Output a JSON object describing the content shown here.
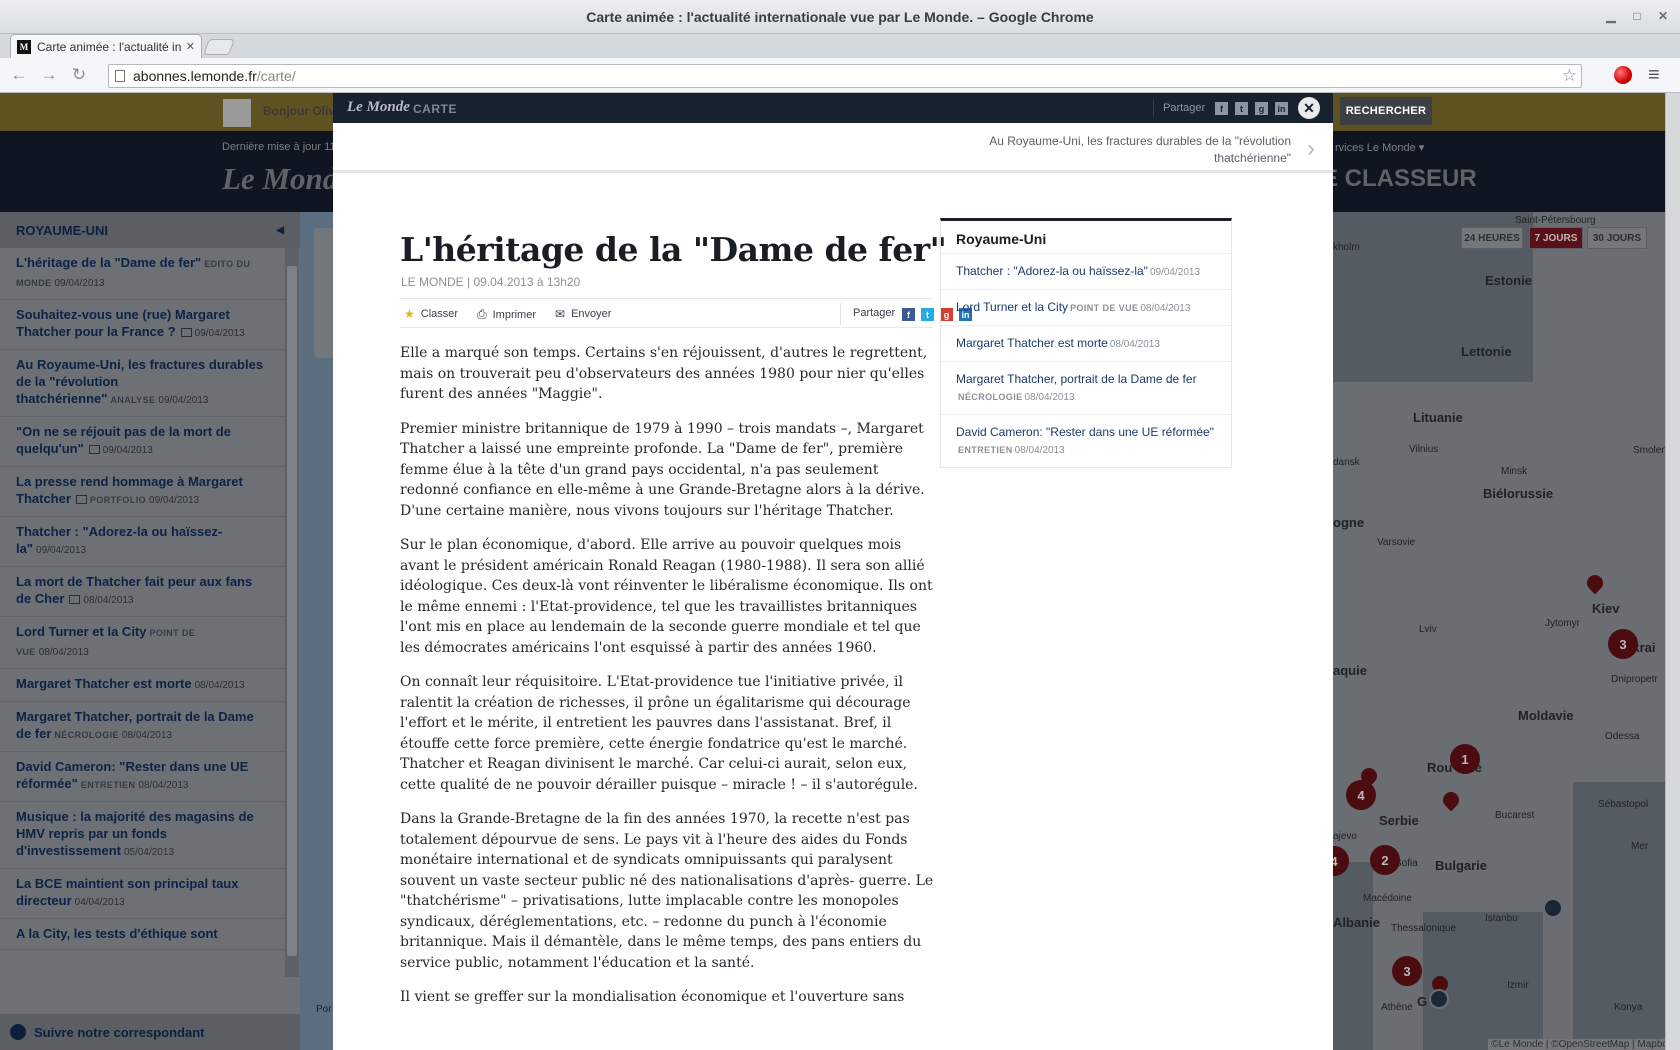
{
  "window": {
    "title": "Carte animée : l'actualité internationale vue par Le Monde. – Google Chrome",
    "tab_title": "Carte animée : l'actualité in",
    "url_host": "abonnes.lemonde.fr",
    "url_path": "/carte/"
  },
  "site": {
    "greeting": "Bonjour Oliv",
    "search_label": "RECHERCHER",
    "last_update": "Dernière mise à jour 11",
    "services": "rvices Le Monde ▾",
    "logo": "Le Monde",
    "classeur": "E CLASSEUR"
  },
  "sidebar": {
    "title": "ROYAUME-UNI",
    "footer": "Suivre notre correspondant",
    "items": [
      {
        "title": "L'héritage de la \"Dame de fer\"",
        "tag": "EDITO DU MONDE",
        "date": "09/04/2013"
      },
      {
        "title": "Souhaitez-vous une (rue) Margaret Thatcher pour la France ?",
        "tag": "",
        "date": "09/04/2013",
        "link": true
      },
      {
        "title": "Au Royaume-Uni, les fractures durables de la \"révolution thatchérienne\"",
        "tag": "ANALYSE",
        "date": "09/04/2013"
      },
      {
        "title": "\"On ne se réjouit pas de la mort de quelqu'un\"",
        "tag": "",
        "date": "09/04/2013",
        "link": true
      },
      {
        "title": "La presse rend hommage à Margaret Thatcher",
        "tag": "PORTFOLIO",
        "date": "09/04/2013",
        "link": true
      },
      {
        "title": "Thatcher : \"Adorez-la ou haïssez-la\"",
        "tag": "",
        "date": "09/04/2013"
      },
      {
        "title": "La mort de Thatcher fait peur aux fans de Cher",
        "tag": "",
        "date": "08/04/2013",
        "link": true
      },
      {
        "title": "Lord Turner et la City",
        "tag": "POINT DE VUE",
        "date": "08/04/2013"
      },
      {
        "title": "Margaret Thatcher est morte",
        "tag": "",
        "date": "08/04/2013"
      },
      {
        "title": "Margaret Thatcher, portrait de la Dame de fer",
        "tag": "NÉCROLOGIE",
        "date": "08/04/2013"
      },
      {
        "title": "David Cameron: \"Rester dans une UE réformée\"",
        "tag": "ENTRETIEN",
        "date": "08/04/2013"
      },
      {
        "title": "Musique : la majorité des magasins de HMV repris par un fonds d'investissement",
        "tag": "",
        "date": "05/04/2013"
      },
      {
        "title": "La BCE maintient son principal taux directeur",
        "tag": "",
        "date": "04/04/2013"
      },
      {
        "title": "A la City, les tests d'éthique sont",
        "tag": "",
        "date": ""
      }
    ]
  },
  "map": {
    "ranges": [
      "24 HEURES",
      "7 JOURS",
      "30 JOURS"
    ],
    "active_range": "7 JOURS",
    "labels": {
      "estonie": "Estonie",
      "lettonie": "Lettonie",
      "lituanie": "Lituanie",
      "bielorussie": "Biélorussie",
      "ukraine": "Ukrai",
      "moldavie": "Moldavie",
      "roumanie": "Rou   anie",
      "bulgarie": "Bulgarie",
      "serbie": "Serbie",
      "albanie": "Albanie",
      "macedoine": "Macédoine",
      "grece": "G   ce",
      "kiev": "Kiev",
      "minsk": "Minsk",
      "vilnius": "Vilnius",
      "varsovie": "Varsovie",
      "lviv": "Lviv",
      "odessa": "Odessa",
      "bucarest": "Bucarest",
      "sofia": "Sofia",
      "istanbul": "Istanbu",
      "izmir": "Izmir",
      "athenes": "Athène",
      "konya": "Konya",
      "sebastopol": "Sébastopol",
      "dnipropetr": "Dnipropetr",
      "jytomyr": "Jytomyr",
      "saint_petersbourg": "Saint-Pétersbourg",
      "stockholm": "kholm",
      "gdansk": "dansk",
      "smolen": "Smolen",
      "ogne": "ogne",
      "aquie": "aquie",
      "ajevo": "ajevo",
      "thessalonique": "Thessalonique",
      "por": "Por",
      "mer": "Mer"
    },
    "cluster_counts": {
      "ukraine": "3",
      "roumanie": "1",
      "serbie": "4",
      "bulgarie": "2",
      "grece": "3",
      "left": "4"
    },
    "copyright": "©Le Monde | ©OpenStreetMap | Mapbox"
  },
  "modal": {
    "brand": "Le Monde",
    "section": "CARTE",
    "share_label": "Partager",
    "next_article": "Au Royaume-Uni, les fractures durables de la \"révolution thatchérienne\"",
    "article": {
      "title": "L'héritage de la \"Dame de fer\"",
      "byline": "LE MONDE | 09.04.2013 à 13h20",
      "tools": {
        "classer": "Classer",
        "imprimer": "Imprimer",
        "envoyer": "Envoyer",
        "partager": "Partager"
      },
      "paragraphs": [
        "Elle a marqué son temps. Certains s'en réjouissent, d'autres le regrettent, mais on trouverait peu d'observateurs des années 1980 pour nier qu'elles furent des années \"Maggie\".",
        "Premier ministre britannique de 1979 à 1990 – trois mandats –, Margaret Thatcher a laissé une empreinte profonde. La \"Dame de fer\", première femme élue à la tête d'un grand pays occidental, n'a pas seulement redonné confiance en elle-même à une Grande-Bretagne alors à la dérive. D'une certaine manière, nous vivons toujours sur l'héritage Thatcher.",
        "Sur le plan économique, d'abord. Elle arrive au pouvoir quelques mois avant le président américain Ronald Reagan (1980-1988). Il sera son allié idéologique. Ces deux-là vont réinventer le libéralisme économique. Ils ont le même ennemi : l'Etat-providence, tel que les travaillistes britanniques l'ont mis en place au lendemain de la seconde guerre mondiale et tel que les démocrates américains l'ont esquissé à partir des années 1960.",
        "On connaît leur réquisitoire. L'Etat-providence tue l'initiative privée, il ralentit la création de richesses, il prône un égalitarisme qui décourage l'effort et le mérite, il entretient les pauvres dans l'assistanat. Bref, il étouffe cette force première, cette énergie fondatrice qu'est le marché. Thatcher et Reagan divinisent le marché. Car celui-ci aurait, selon eux, cette qualité de ne pouvoir dérailler puisque – miracle ! – il s'autorégule.",
        "Dans la Grande-Bretagne de la fin des années 1970, la recette n'est pas totalement dépourvue de sens. Le pays vit à l'heure des aides du Fonds monétaire international et de syndicats omnipuissants qui paralysent souvent un vaste secteur public né des nationalisations d'après- guerre. Le \"thatchérisme\" – privatisations, lutte implacable contre les monopoles syndicaux, déréglementations, etc. – redonne du punch à l'économie britannique. Mais il démantèle, dans le même temps, des pans entiers du service public, notamment l'éducation et la santé.",
        "Il vient se greffer sur la mondialisation économique et l'ouverture sans"
      ]
    },
    "related": {
      "title": "Royaume-Uni",
      "items": [
        {
          "title": "Thatcher : \"Adorez-la ou haïssez-la\"",
          "tag": "",
          "date": "09/04/2013"
        },
        {
          "title": "Lord Turner et la City",
          "tag": "POINT DE VUE",
          "date": "08/04/2013"
        },
        {
          "title": "Margaret Thatcher est morte",
          "tag": "",
          "date": "08/04/2013"
        },
        {
          "title": "Margaret Thatcher, portrait de la Dame de fer",
          "tag": "NÉCROLOGIE",
          "date": "08/04/2013"
        },
        {
          "title": "David Cameron: \"Rester dans une UE réformée\"",
          "tag": "ENTRETIEN",
          "date": "08/04/2013"
        }
      ]
    }
  }
}
